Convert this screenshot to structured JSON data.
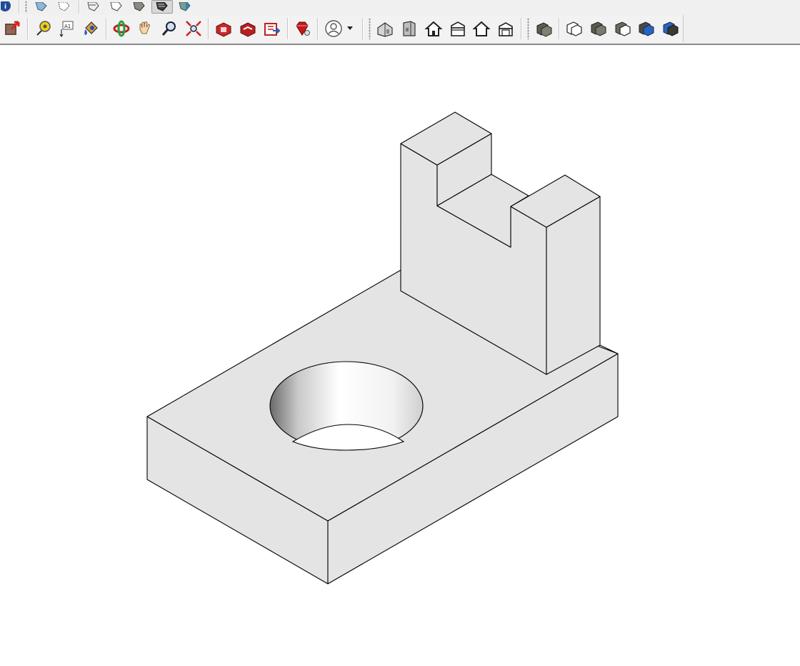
{
  "toolbar": {
    "row1": [
      {
        "name": "model-info-icon",
        "active": false
      },
      {
        "name": "xray-style-icon",
        "active": false
      },
      {
        "name": "back-edges-style-icon",
        "active": false
      },
      {
        "name": "wireframe-style-icon",
        "active": false
      },
      {
        "name": "hidden-line-style-icon",
        "active": false
      },
      {
        "name": "shaded-style-icon",
        "active": false
      },
      {
        "name": "shaded-with-textures-style-icon",
        "active": true
      },
      {
        "name": "monochrome-style-icon",
        "active": false
      }
    ],
    "row2": [
      "select-arrow-icon",
      "tape-measure-icon",
      "text-tool-icon",
      "paint-bucket-icon",
      "orbit-icon",
      "pan-hand-icon",
      "zoom-icon",
      "zoom-extents-icon",
      "warehouse-icon",
      "share-model-icon",
      "extension-warehouse-icon",
      "ruby-console-icon",
      "account-avatar-icon",
      "iso-view-icon",
      "front-view-icon",
      "top-view-icon",
      "right-view-icon",
      "back-view-icon",
      "left-view-icon",
      "outer-shell-icon",
      "union-icon",
      "subtract-icon",
      "trim-icon",
      "intersect-icon",
      "split-icon"
    ]
  },
  "viewport": {
    "background_color": "#ffffff",
    "face_color": "#e4e4e4",
    "edge_color": "#000000"
  }
}
